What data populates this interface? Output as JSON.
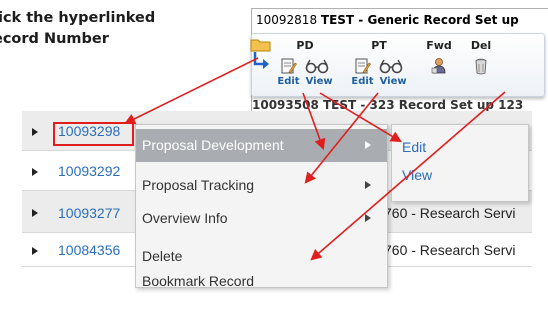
{
  "instruction": {
    "line1": "lick the hyperlinked",
    "line2": "ecord Number"
  },
  "toolbar": {
    "title_number": "10092818",
    "title_text": "TEST - Generic Record Set up",
    "behind_text": "10093508 TEST - 323 Record Set up 123",
    "groups": [
      {
        "heading": "PD",
        "links": [
          "Edit",
          "View"
        ]
      },
      {
        "heading": "PT",
        "links": [
          "Edit",
          "View"
        ]
      },
      {
        "heading": "Fwd",
        "links": []
      },
      {
        "heading": "Del",
        "links": []
      }
    ]
  },
  "table": {
    "rows": [
      {
        "number": "10093298",
        "desc": ""
      },
      {
        "number": "10093292",
        "desc": ""
      },
      {
        "number": "10093277",
        "desc": "760 - Research Servi"
      },
      {
        "number": "10084356",
        "desc": "760 - Research Servi"
      }
    ]
  },
  "context_menu": {
    "items": [
      {
        "label": "Proposal Development",
        "has_submenu": true,
        "active": true
      },
      {
        "label": "Proposal Tracking",
        "has_submenu": true,
        "active": false
      },
      {
        "label": "Overview Info",
        "has_submenu": true,
        "active": false
      },
      {
        "label": "Delete",
        "has_submenu": false,
        "active": false
      },
      {
        "label": "Bookmark Record",
        "has_submenu": false,
        "active": false
      }
    ]
  },
  "sub_menu": {
    "items": [
      {
        "label": "Edit"
      },
      {
        "label": "View"
      }
    ]
  },
  "colors": {
    "accent_red": "#e01e1e",
    "link_blue": "#2a6ebb",
    "menu_active": "#a9adb1"
  }
}
